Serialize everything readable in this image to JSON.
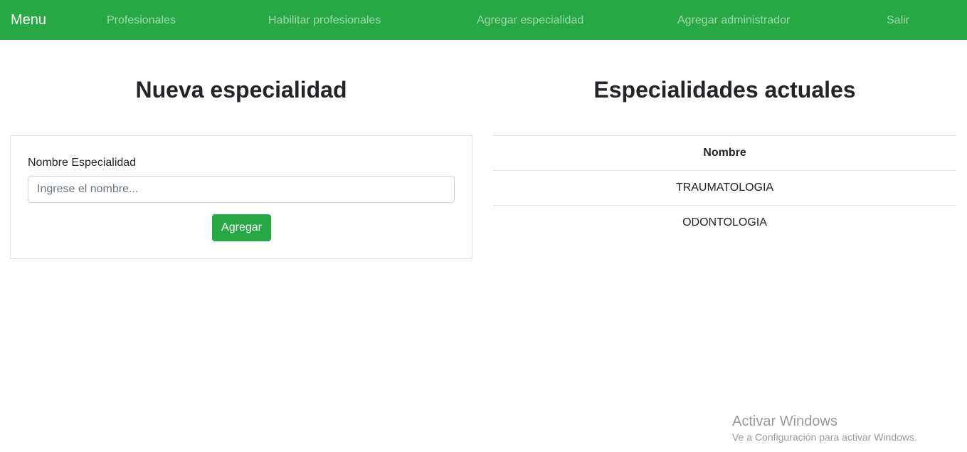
{
  "navbar": {
    "brand": "Menu",
    "links": [
      {
        "label": "Profesionales"
      },
      {
        "label": "Habilitar profesionales"
      },
      {
        "label": "Agregar especialidad"
      },
      {
        "label": "Agregar administrador"
      },
      {
        "label": "Salir"
      }
    ],
    "color": "#28a745"
  },
  "form_section": {
    "title": "Nueva especialidad",
    "field_label": "Nombre Especialidad",
    "input_value": "",
    "input_placeholder": "Ingrese el nombre...",
    "submit_label": "Agregar"
  },
  "list_section": {
    "title": "Especialidades actuales",
    "column_header": "Nombre",
    "rows": [
      {
        "nombre": "TRAUMATOLOGIA"
      },
      {
        "nombre": "ODONTOLOGIA"
      }
    ]
  },
  "os_watermark": {
    "title": "Activar Windows",
    "subtitle": "Ve a Configuración para activar Windows."
  }
}
